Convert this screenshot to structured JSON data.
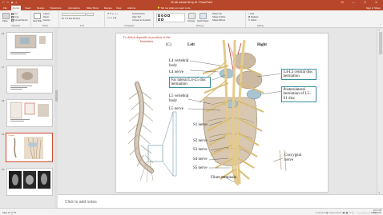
{
  "app": {
    "title": "02-Intl column 8b up.rtf - PowerPoint",
    "quick_access": "↶ ↷ ▣ ▾",
    "window_controls": "⊡ — ☐ ✕"
  },
  "tabs": [
    "File",
    "Home",
    "Insert",
    "Design",
    "Transitions",
    "Animations",
    "Slide Show",
    "Review",
    "View",
    "Add-ins"
  ],
  "tell_me": "Tell me what you want to do",
  "tabs_right": "Sign in  Share",
  "ribbon": {
    "clipboard": {
      "paste": "Paste",
      "cut": "Cut",
      "copy": "Copy",
      "format_painter": "Format Painter",
      "label": "Clipboard"
    },
    "slides": {
      "new_slide": "New Slide",
      "layout": "Layout",
      "reset": "Reset",
      "section": "Section",
      "label": "Slides"
    },
    "font": {
      "name": "",
      "size": "",
      "label": "Font",
      "format_buttons": "B I U S abc AV Aa A"
    },
    "paragraph": {
      "label": "Paragraph",
      "text_direction": "Text Direction",
      "align_text": "Align Text",
      "smartart": "Convert to SmartArt"
    },
    "drawing": {
      "label": "Drawing",
      "arrange": "Arrange",
      "quick_styles": "Quick Styles",
      "shape_fill": "Shape Fill",
      "shape_outline": "Shape Outline",
      "shape_effects": "Shape Effects"
    },
    "editing": {
      "find": "Find",
      "replace": "Replace",
      "select": "Select",
      "label": "Editing"
    }
  },
  "thumbnails": {
    "numbers": [
      "16",
      "17",
      "18",
      "19",
      "20"
    ],
    "selected": "19"
  },
  "slide": {
    "caption": "Tx deficit depends on position of the herniation",
    "panel_letter": "(C)",
    "side_left": "Left",
    "side_right": "Right",
    "labels": {
      "l4_body": "L4 vertebral body",
      "l4_nerve": "L4 nerve",
      "far_lateral": "Far lateral L4-L5 disc herniation",
      "l5_body": "L5 vertebral body",
      "l5_nerve": "L5 nerve",
      "s1": "S1 nerve",
      "s2": "S2 nerve",
      "s3": "S3 nerve",
      "s4": "S4 nerve",
      "s5": "S5 nerve",
      "filum": "Filum terminale",
      "coccygeal": "Coccygeal nerve",
      "l4l5_central": "L4-L5 central disc herniation",
      "posterolateral": "Posterolateral herniation of L5-S1 disc"
    }
  },
  "notes": {
    "placeholder": "Click to add notes"
  },
  "status": {
    "slide_info": "Slide 19 of 35",
    "right": "≡ Notes  ▤ Comments  ▣ ▦ ▭ ▷",
    "zoom": "− ——+—— + 100%",
    "time": "10:27 AM",
    "date": "4/11/2017"
  },
  "colors": {
    "accent": "#b7472a",
    "caption_red": "#c0392b",
    "box_border": "#3a8fa3",
    "selected_border": "#d04a2f"
  }
}
